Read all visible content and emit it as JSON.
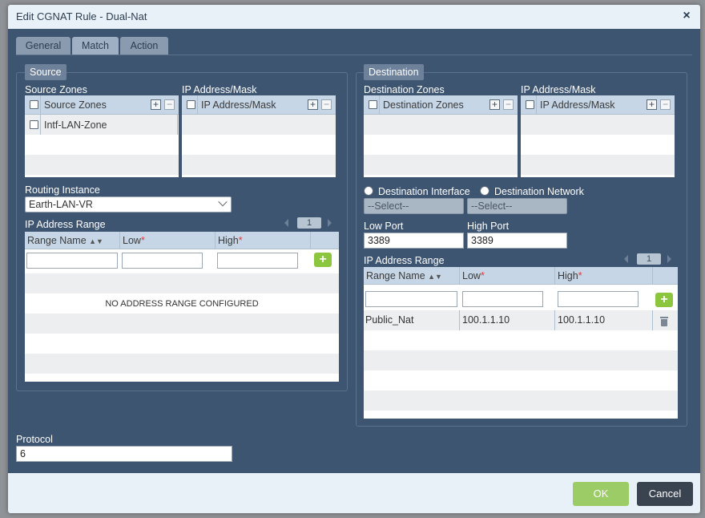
{
  "dialog": {
    "title": "Edit CGNAT Rule - Dual-Nat"
  },
  "tabs": [
    {
      "label": "General"
    },
    {
      "label": "Match"
    },
    {
      "label": "Action"
    }
  ],
  "source": {
    "legend": "Source",
    "zones_label": "Source Zones",
    "zones_header": "Source Zones",
    "zones": [
      "Intf-LAN-Zone"
    ],
    "ipmask_label": "IP Address/Mask",
    "ipmask_header": "IP Address/Mask",
    "routing_instance_label": "Routing Instance",
    "routing_instance_value": "Earth-LAN-VR",
    "ip_range_label": "IP Address Range",
    "page": "1",
    "columns": [
      "Range Name",
      "Low",
      "High"
    ],
    "empty_message": "NO ADDRESS RANGE CONFIGURED"
  },
  "destination": {
    "legend": "Destination",
    "zones_label": "Destination Zones",
    "zones_header": "Destination Zones",
    "ipmask_label": "IP Address/Mask",
    "ipmask_header": "IP Address/Mask",
    "radio_interface": "Destination Interface",
    "radio_network": "Destination Network",
    "select_placeholder_1": "--Select--",
    "select_placeholder_2": "--Select--",
    "low_port_label": "Low Port",
    "low_port_value": "3389",
    "high_port_label": "High Port",
    "high_port_value": "3389",
    "ip_range_label": "IP Address Range",
    "page": "1",
    "columns": [
      "Range Name",
      "Low",
      "High"
    ],
    "rows": [
      {
        "name": "Public_Nat",
        "low": "100.1.1.10",
        "high": "100.1.1.10"
      }
    ]
  },
  "protocol": {
    "label": "Protocol",
    "value": "6"
  },
  "buttons": {
    "ok": "OK",
    "cancel": "Cancel"
  },
  "colors": {
    "accent_ok": "#9ccc65",
    "dialog_body": "#3e5571",
    "required": "#e23b3b"
  }
}
